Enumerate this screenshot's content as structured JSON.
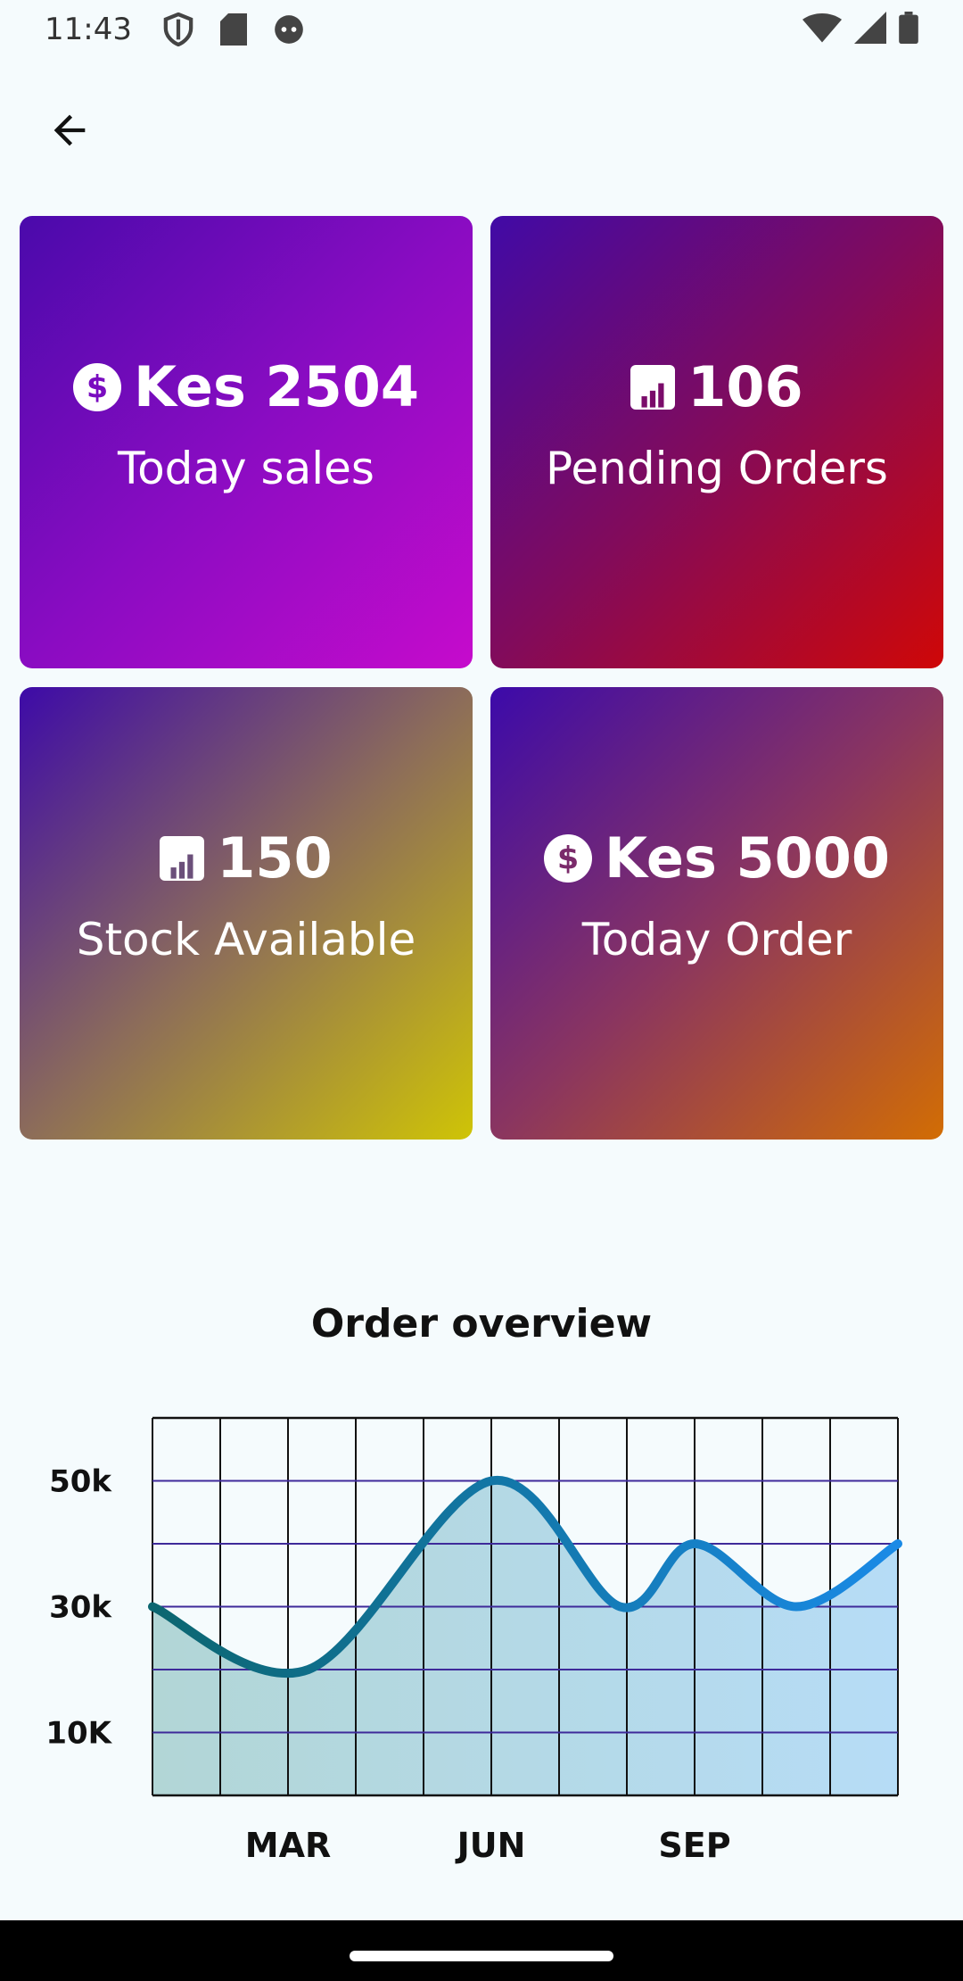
{
  "status_bar": {
    "time": "11:43",
    "icons": [
      "shield-icon",
      "sd-card-icon",
      "android-face-icon",
      "wifi-icon",
      "signal-icon",
      "battery-icon"
    ]
  },
  "header": {
    "back_icon": "arrow-back-icon"
  },
  "cards": [
    {
      "icon": "dollar-circle-icon",
      "value": "Kes 2504",
      "label": "Today sales",
      "gradient": [
        "#4a0aab",
        "#c60bcc"
      ]
    },
    {
      "icon": "bar-chart-icon",
      "value": "106",
      "label": "Pending Orders",
      "gradient": [
        "#410aa6",
        "#cf0707"
      ]
    },
    {
      "icon": "bar-chart-icon",
      "value": "150",
      "label": "Stock Available",
      "gradient": [
        "#3d0aa8",
        "#cfc406"
      ]
    },
    {
      "icon": "dollar-circle-icon",
      "value": "Kes 5000",
      "label": "Today Order",
      "gradient": [
        "#3c0aaa",
        "#d26d04"
      ]
    }
  ],
  "chart_title": "Order overview",
  "chart_data": {
    "type": "area",
    "title": "Order overview",
    "x": [
      0,
      2.3,
      5.0,
      6.9,
      8.0,
      9.5,
      11
    ],
    "y": [
      30000,
      20000,
      50000,
      30000,
      40000,
      30000,
      40000
    ],
    "xlim": [
      0,
      11
    ],
    "ylim": [
      0,
      60000
    ],
    "x_ticks": [
      {
        "value": 2,
        "label": "MAR"
      },
      {
        "value": 5,
        "label": "JUN"
      },
      {
        "value": 8,
        "label": "SEP"
      }
    ],
    "y_ticks": [
      {
        "value": 10000,
        "label": "10K"
      },
      {
        "value": 30000,
        "label": "30k"
      },
      {
        "value": 50000,
        "label": "50k"
      }
    ],
    "grid": true,
    "line_colors": [
      "#0c6670",
      "#1a8ae6"
    ],
    "fill_colors": [
      "#b2d6d6",
      "#b6dcf6"
    ],
    "hline_color": "#3e2a9a"
  }
}
